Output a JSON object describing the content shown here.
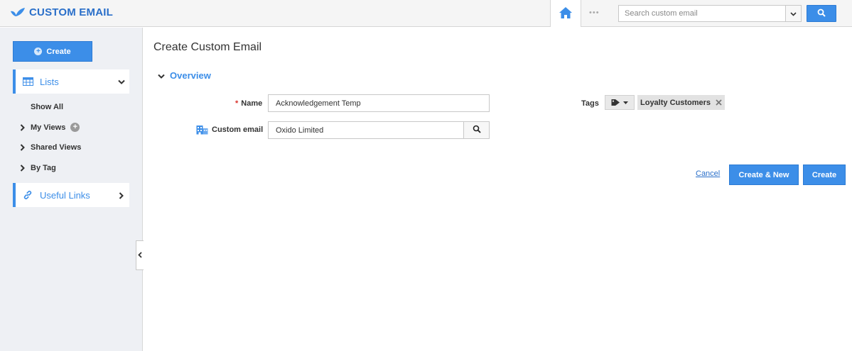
{
  "header": {
    "brand": "CUSTOM EMAIL",
    "brand_color": "#2a6fc9",
    "more_glyph": "•••",
    "search": {
      "placeholder": "Search custom email",
      "value": ""
    }
  },
  "sidebar": {
    "create_label": "Create",
    "lists_label": "Lists",
    "items": [
      {
        "label": "Show All"
      },
      {
        "label": "My Views"
      },
      {
        "label": "Shared Views"
      },
      {
        "label": "By Tag"
      }
    ],
    "useful_links_label": "Useful Links"
  },
  "main": {
    "title": "Create Custom Email",
    "section": "Overview",
    "fields": {
      "name_label": "Name",
      "name_required_mark": "*",
      "name_value": "Acknowledgement Temp",
      "custom_email_label": "Custom email",
      "custom_email_value": "Oxido Limited",
      "tags_label": "Tags",
      "tags": [
        "Loyalty Customers"
      ]
    },
    "actions": {
      "cancel": "Cancel",
      "create_new": "Create & New",
      "create": "Create"
    }
  },
  "colors": {
    "accent": "#3c8ee8",
    "sidebar_bg": "#eef0f4",
    "required": "#d9322c"
  }
}
